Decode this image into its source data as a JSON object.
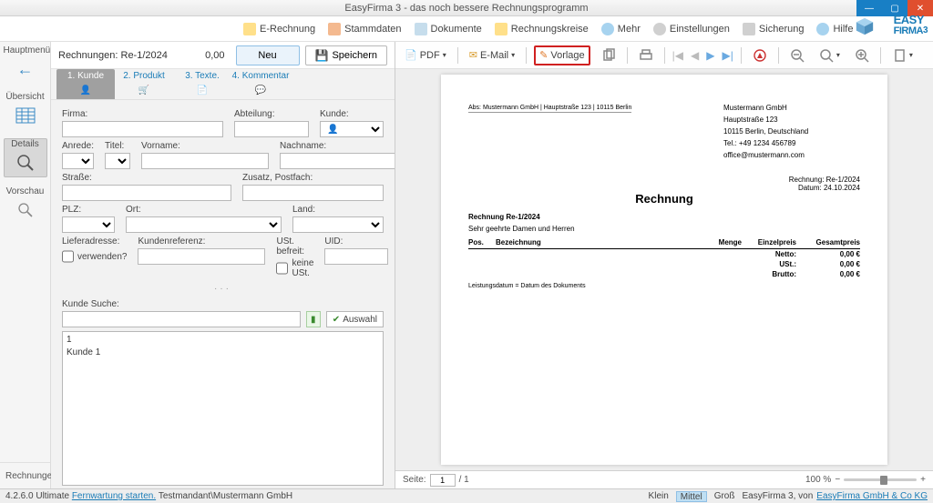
{
  "app": {
    "title": "EasyFirma 3 - das noch bessere Rechnungsprogramm",
    "brand_top": "EASY",
    "brand_bottom": "FIRMA",
    "brand_suffix": "3"
  },
  "menubar": {
    "items": [
      {
        "label": "E-Rechnung",
        "color": "#f0b400"
      },
      {
        "label": "Stammdaten",
        "color": "#e05a2b"
      },
      {
        "label": "Dokumente",
        "color": "#2b87c7"
      },
      {
        "label": "Rechnungskreise",
        "color": "#f0b400"
      },
      {
        "label": "Mehr",
        "color": "#2b87c7"
      },
      {
        "label": "Einstellungen",
        "color": "#888"
      },
      {
        "label": "Sicherung",
        "color": "#888"
      },
      {
        "label": "Hilfe",
        "color": "#888"
      }
    ]
  },
  "leftnav": {
    "items": [
      "Hauptmenü",
      "Übersicht",
      "Details",
      "Vorschau"
    ],
    "bottom": "Rechnungen"
  },
  "form": {
    "header_label": "Rechnungen: Re-1/2024",
    "amount": "0,00",
    "btn_new": "Neu",
    "btn_save": "Speichern",
    "tabs": [
      "1. Kunde",
      "2. Produkt",
      "3. Texte.",
      "4. Kommentar"
    ],
    "labels": {
      "firma": "Firma:",
      "abteilung": "Abteilung:",
      "kunde": "Kunde:",
      "anrede": "Anrede:",
      "titel": "Titel:",
      "vorname": "Vorname:",
      "nachname": "Nachname:",
      "strasse": "Straße:",
      "zusatz": "Zusatz, Postfach:",
      "plz": "PLZ:",
      "ort": "Ort:",
      "land": "Land:",
      "liefer": "Lieferadresse:",
      "verwenden": "verwenden?",
      "kundenref": "Kundenreferenz:",
      "ustb": "USt. befreit:",
      "keineust": "keine USt.",
      "uid": "UID:",
      "ksuche": "Kunde Suche:",
      "auswahl": "Auswahl"
    },
    "list": [
      "1",
      "Kunde 1"
    ]
  },
  "previewToolbar": {
    "pdf": "PDF",
    "email": "E-Mail",
    "vorlage": "Vorlage"
  },
  "doc": {
    "sender_small": "Abs: Mustermann GmbH | Hauptstraße 123 | 10115 Berlin",
    "addr": {
      "name": "Mustermann GmbH",
      "street": "Hauptstraße 123",
      "city": "10115 Berlin, Deutschland",
      "tel": "Tel.: +49 1234 456789",
      "email": "office@mustermann.com"
    },
    "meta": {
      "rnr": "Rechnung: Re-1/2024",
      "datum": "Datum: 24.10.2024"
    },
    "heading": "Rechnung",
    "rnr_line": "Rechnung Re-1/2024",
    "greet": "Sehr geehrte Damen und Herren",
    "cols": {
      "pos": "Pos.",
      "bez": "Bezeichnung",
      "menge": "Menge",
      "ep": "Einzelpreis",
      "gp": "Gesamtpreis"
    },
    "totals": [
      {
        "label": "Netto:",
        "value": "0,00 €"
      },
      {
        "label": "USt.:",
        "value": "0,00 €"
      },
      {
        "label": "Brutto:",
        "value": "0,00 €"
      }
    ],
    "note": "Leistungsdatum = Datum des Dokuments"
  },
  "pager": {
    "seite": "Seite:",
    "page": "1",
    "total": "/ 1",
    "zoom": "100 %"
  },
  "status": {
    "version": "4.2.6.0 Ultimate",
    "remote": "Fernwartung starten.",
    "mandant": "Testmandant\\Mustermann GmbH",
    "size_labels": [
      "Klein",
      "Mittel",
      "Groß"
    ],
    "tail1": "EasyFirma 3, von",
    "tail2": "EasyFirma GmbH & Co KG"
  }
}
